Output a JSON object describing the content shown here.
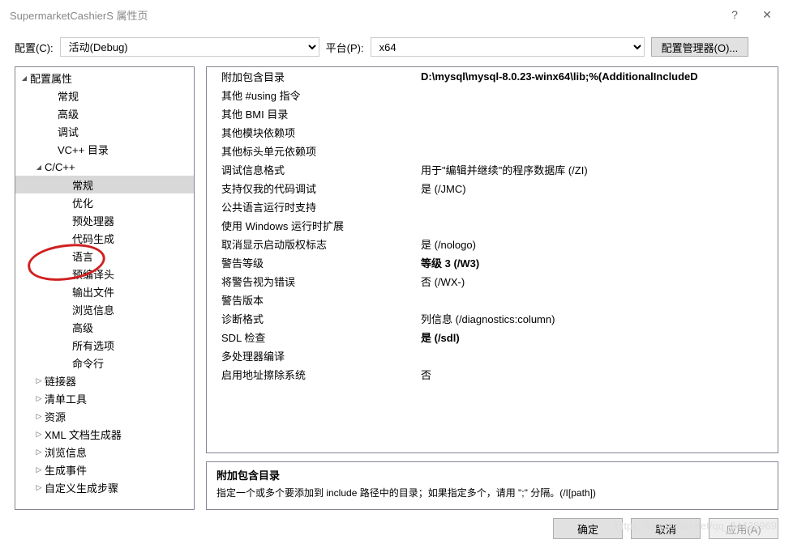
{
  "titlebar": {
    "title": "SupermarketCashierS 属性页",
    "help": "?",
    "close": "✕"
  },
  "toolbar": {
    "config_label": "配置(C):",
    "config_value": "活动(Debug)",
    "platform_label": "平台(P):",
    "platform_value": "x64",
    "config_mgr": "配置管理器(O)..."
  },
  "tree": [
    {
      "label": "配置属性",
      "indent": "indent-0",
      "arrow": "open"
    },
    {
      "label": "常规",
      "indent": "indent-1"
    },
    {
      "label": "高级",
      "indent": "indent-1"
    },
    {
      "label": "调试",
      "indent": "indent-1"
    },
    {
      "label": "VC++ 目录",
      "indent": "indent-1"
    },
    {
      "label": "C/C++",
      "indent": "indent-1b",
      "arrow": "open"
    },
    {
      "label": "常规",
      "indent": "indent-2",
      "selected": true
    },
    {
      "label": "优化",
      "indent": "indent-2"
    },
    {
      "label": "预处理器",
      "indent": "indent-2"
    },
    {
      "label": "代码生成",
      "indent": "indent-2"
    },
    {
      "label": "语言",
      "indent": "indent-2"
    },
    {
      "label": "预编译头",
      "indent": "indent-2"
    },
    {
      "label": "输出文件",
      "indent": "indent-2"
    },
    {
      "label": "浏览信息",
      "indent": "indent-2"
    },
    {
      "label": "高级",
      "indent": "indent-2"
    },
    {
      "label": "所有选项",
      "indent": "indent-2"
    },
    {
      "label": "命令行",
      "indent": "indent-2"
    },
    {
      "label": "链接器",
      "indent": "indent-1b",
      "arrow": "closed"
    },
    {
      "label": "清单工具",
      "indent": "indent-1b",
      "arrow": "closed"
    },
    {
      "label": "资源",
      "indent": "indent-1b",
      "arrow": "closed"
    },
    {
      "label": "XML 文档生成器",
      "indent": "indent-1b",
      "arrow": "closed"
    },
    {
      "label": "浏览信息",
      "indent": "indent-1b",
      "arrow": "closed"
    },
    {
      "label": "生成事件",
      "indent": "indent-1b",
      "arrow": "closed"
    },
    {
      "label": "自定义生成步骤",
      "indent": "indent-1b",
      "arrow": "closed"
    }
  ],
  "props": [
    {
      "label": "附加包含目录",
      "value": "D:\\mysql\\mysql-8.0.23-winx64\\lib;%(AdditionalIncludeD",
      "bold": true,
      "underline": true
    },
    {
      "label": "其他 #using 指令",
      "value": ""
    },
    {
      "label": "其他 BMI 目录",
      "value": ""
    },
    {
      "label": "其他模块依赖项",
      "value": ""
    },
    {
      "label": "其他标头单元依赖项",
      "value": ""
    },
    {
      "label": "调试信息格式",
      "value": "用于\"编辑并继续\"的程序数据库 (/ZI)"
    },
    {
      "label": "支持仅我的代码调试",
      "value": "是 (/JMC)"
    },
    {
      "label": "公共语言运行时支持",
      "value": ""
    },
    {
      "label": "使用 Windows 运行时扩展",
      "value": ""
    },
    {
      "label": "取消显示启动版权标志",
      "value": "是 (/nologo)"
    },
    {
      "label": "警告等级",
      "value": "等级 3 (/W3)",
      "bold": true
    },
    {
      "label": "将警告视为错误",
      "value": "否 (/WX-)"
    },
    {
      "label": "警告版本",
      "value": ""
    },
    {
      "label": "诊断格式",
      "value": "列信息 (/diagnostics:column)"
    },
    {
      "label": "SDL 检查",
      "value": "是 (/sdl)",
      "bold": true
    },
    {
      "label": "多处理器编译",
      "value": ""
    },
    {
      "label": "启用地址擦除系统",
      "value": "否"
    }
  ],
  "desc": {
    "title": "附加包含目录",
    "text": "指定一个或多个要添加到 include 路径中的目录；如果指定多个，请用 \";\" 分隔。(/I[path])"
  },
  "footer": {
    "ok": "确定",
    "cancel": "取消",
    "apply": "应用(A)"
  },
  "watermark": "https://blog.csdn.net/qq_34438969"
}
